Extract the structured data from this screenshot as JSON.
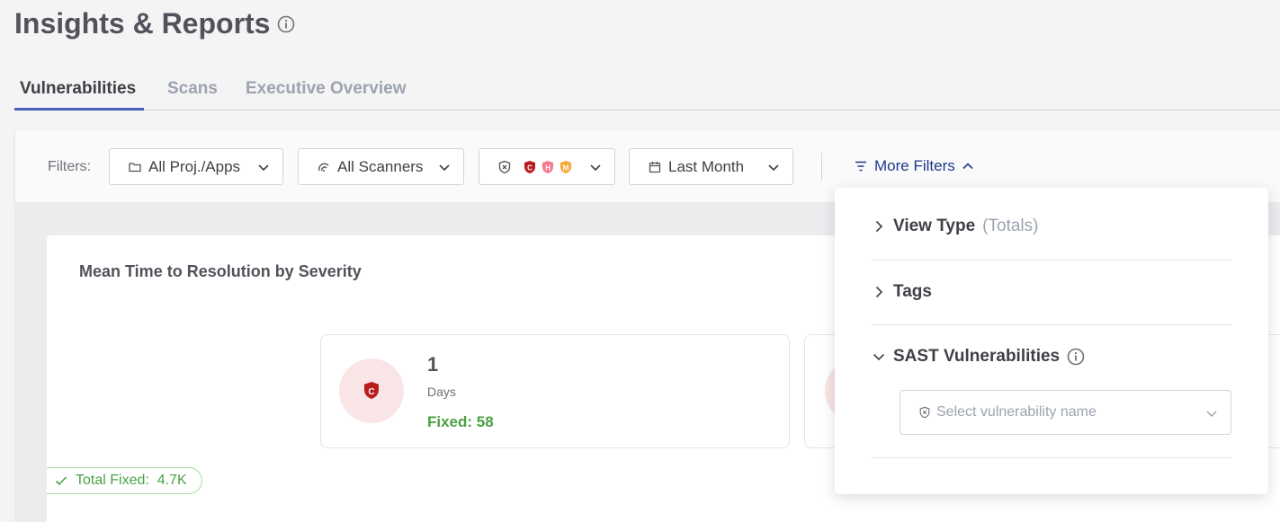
{
  "page": {
    "title": "Insights & Reports"
  },
  "tabs": [
    {
      "label": "Vulnerabilities",
      "active": true
    },
    {
      "label": "Scans",
      "active": false
    },
    {
      "label": "Executive Overview",
      "active": false
    }
  ],
  "filters": {
    "label": "Filters:",
    "projects": "All Proj./Apps",
    "scanners": "All Scanners",
    "severity_badges": [
      {
        "letter": "C",
        "color": "#b91c1c"
      },
      {
        "letter": "H",
        "color": "#f47b8e"
      },
      {
        "letter": "M",
        "color": "#f5a938"
      }
    ],
    "date": "Last Month",
    "more_filters": "More Filters"
  },
  "card": {
    "title": "Mean Time to Resolution by Severity",
    "severity_cards": [
      {
        "severity": "C",
        "value": "1",
        "unit": "Days",
        "fixed": "Fixed: 58",
        "color": "#b91c1c"
      }
    ],
    "total_fixed": "Total Fixed:  4.7K"
  },
  "more_filters_panel": {
    "view_type": {
      "label": "View Type",
      "sub": "(Totals)"
    },
    "tags": {
      "label": "Tags"
    },
    "sast": {
      "label": "SAST Vulnerabilities",
      "placeholder": "Select vulnerability name"
    }
  },
  "colors": {
    "accent": "#4c5fb8",
    "link": "#1e3a8a",
    "success": "#4aa145",
    "critical": "#b91c1c"
  }
}
